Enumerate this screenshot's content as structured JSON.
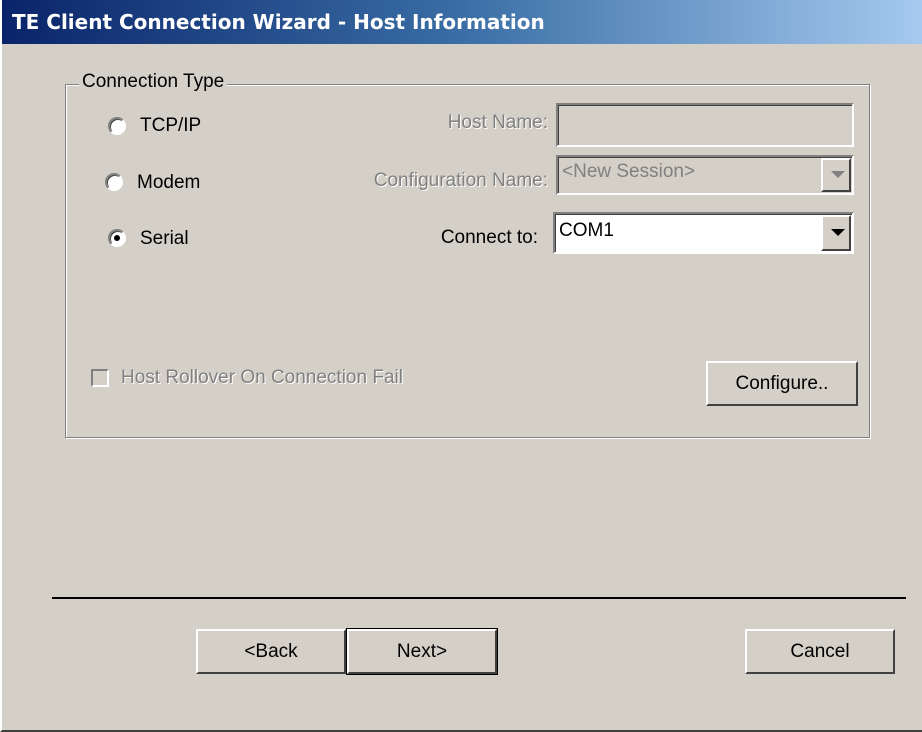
{
  "window": {
    "title": "TE Client Connection Wizard - Host Information"
  },
  "connection_type": {
    "legend": "Connection Type",
    "options": [
      {
        "label": "TCP/IP",
        "checked": false
      },
      {
        "label": "Modem",
        "checked": false
      },
      {
        "label": "Serial",
        "checked": true
      }
    ]
  },
  "fields": {
    "host_name": {
      "label": "Host Name:",
      "value": "",
      "enabled": false
    },
    "configuration_name": {
      "label": "Configuration Name:",
      "value": "<New Session>",
      "enabled": false
    },
    "connect_to": {
      "label": "Connect to:",
      "value": "COM1",
      "enabled": true
    }
  },
  "host_rollover": {
    "label": "Host Rollover On Connection Fail",
    "checked": false,
    "enabled": false
  },
  "buttons": {
    "configure": "Configure..",
    "back": "<Back",
    "next": "Next>",
    "cancel": "Cancel"
  },
  "colors": {
    "face": "#d4d0c8",
    "title_start": "#0a246a",
    "title_end": "#a6caf0",
    "disabled_text": "#808080"
  }
}
